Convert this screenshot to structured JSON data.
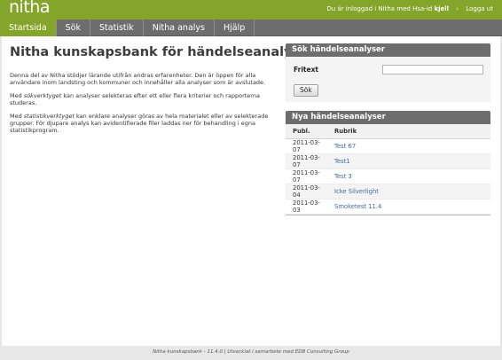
{
  "header": {
    "logo": "nitha",
    "login_prefix": "Du är inloggad i Nitha med Hsa-id",
    "username": "kjell",
    "separator": "›",
    "logout": "Logga ut"
  },
  "nav": {
    "tabs": [
      {
        "label": "Startsida",
        "active": true
      },
      {
        "label": "Sök",
        "active": false
      },
      {
        "label": "Statistik",
        "active": false
      },
      {
        "label": "Nitha analys",
        "active": false
      },
      {
        "label": "Hjälp",
        "active": false
      }
    ]
  },
  "main": {
    "title": "Nitha kunskapsbank för händelseanalyser",
    "p1": "Denna del av Nitha stödjer lärande utifrån andras erfarenheter. Den är öppen för alla användare inom landsting och kommuner och innehåller alla analyser som är avslutade.",
    "p2_prefix": "Med ",
    "p2_em": "sökverktyget",
    "p2_suffix": " kan analyser selekteras efter ett eller flera kriterier och rapporterna studeras.",
    "p3_prefix": "Med ",
    "p3_em": "statistikverktyget",
    "p3_suffix": " kan enklare analyser göras av hela materialet eller av selekterade grupper. För djupare analys kan avidentifierade filer laddas ner för behandling i egna statistikprogram."
  },
  "search_panel": {
    "title": "Sök händelseanalyser",
    "label": "Fritext",
    "value": "",
    "button": "Sök"
  },
  "news_panel": {
    "title": "Nya händelseanalyser",
    "col_date": "Publ.",
    "col_title": "Rubrik",
    "rows": [
      {
        "date": "2011-03-07",
        "title": "Test 67"
      },
      {
        "date": "2011-03-07",
        "title": "Test1"
      },
      {
        "date": "2011-03-07",
        "title": "Test 3"
      },
      {
        "date": "2011-03-04",
        "title": "Icke Silverlight"
      },
      {
        "date": "2011-03-03",
        "title": "Smoketest 11.4"
      }
    ]
  },
  "footer": {
    "text": "Nitha kunskapsbank - 11.4.0  |  Utvecklat i samarbete med EDB Consulting Group"
  },
  "colors": {
    "brand_green": "#83a52a",
    "nav_gray": "#6d6d6d",
    "link_blue": "#3b6aa8"
  }
}
